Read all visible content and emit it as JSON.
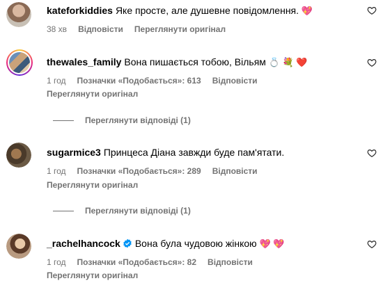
{
  "comments": [
    {
      "username": "kateforkiddies",
      "text": "Яке просте, але душевне повідомлення.",
      "emoji": "💖",
      "time": "38 хв",
      "reply": "Відповісти",
      "see_original": "Переглянути оригінал"
    },
    {
      "username": "thewales_family",
      "text": "Вона пишається тобою, Вільям",
      "emoji": "💍 💐 ❤️",
      "time": "1 год",
      "likes": "Позначки «Подобається»: 613",
      "reply": "Відповісти",
      "see_original": "Переглянути оригінал",
      "view_replies": "Переглянути відповіді (1)"
    },
    {
      "username": "sugarmice3",
      "text": "Принцеса Діана завжди буде пам'ятати.",
      "time": "1 год",
      "likes": "Позначки «Подобається»: 289",
      "reply": "Відповісти",
      "see_original": "Переглянути оригінал",
      "view_replies": "Переглянути відповіді (1)"
    },
    {
      "username": "_rachelhancock",
      "text": "Вона була чудовою жінкою",
      "emoji": "💖 💖",
      "time": "1 год",
      "likes": "Позначки «Подобається»: 82",
      "reply": "Відповісти",
      "see_original": "Переглянути оригінал"
    }
  ],
  "colors": {
    "secondary_text": "#737373",
    "verified": "#0095f6",
    "ring_start": "#f9ce34",
    "ring_end": "#6228d7"
  }
}
